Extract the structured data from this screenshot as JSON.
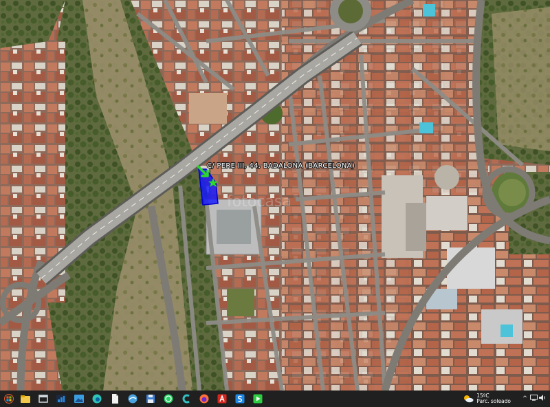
{
  "map": {
    "view": "satellite",
    "placemark": {
      "label": "C/ PERE III, 44, BADALONA (BARCELONA)",
      "parcel_color": "#1417ff",
      "marker_color": "#2bd92b"
    },
    "watermark": "fotocasa"
  },
  "taskbar": {
    "start_icon": "windows-logo-icon",
    "pinned": [
      {
        "name": "taskbar-item-explorer",
        "icon": "file-explorer-icon",
        "color": "#f2c94c"
      },
      {
        "name": "taskbar-item-windows",
        "icon": "window-icon",
        "color": "#cfd8dc"
      },
      {
        "name": "taskbar-item-photos",
        "icon": "photos-icon",
        "color": "#2a8ae0"
      },
      {
        "name": "taskbar-item-gallery",
        "icon": "landscape-icon",
        "color": "#3b9de0"
      },
      {
        "name": "taskbar-item-edge",
        "icon": "edge-icon",
        "color": "#2ec4b6"
      },
      {
        "name": "taskbar-item-document",
        "icon": "document-icon",
        "color": "#f2f2f2"
      },
      {
        "name": "taskbar-item-earth",
        "icon": "google-earth-icon",
        "color": "#4aa3df"
      },
      {
        "name": "taskbar-item-save",
        "icon": "floppy-disk-icon",
        "color": "#3d7fd1"
      },
      {
        "name": "taskbar-item-whatsapp",
        "icon": "whatsapp-icon",
        "color": "#25d366"
      },
      {
        "name": "taskbar-item-app",
        "icon": "c-logo-icon",
        "color": "#33c1c1"
      },
      {
        "name": "taskbar-item-firefox",
        "icon": "firefox-icon",
        "color": "#ff7139"
      },
      {
        "name": "taskbar-item-acrobat",
        "icon": "acrobat-icon",
        "color": "#d7261e"
      },
      {
        "name": "taskbar-item-s-app",
        "icon": "s-logo-icon",
        "color": "#1e88e5"
      },
      {
        "name": "taskbar-item-green-app",
        "icon": "green-app-icon",
        "color": "#2ecc40"
      }
    ],
    "weather": {
      "temp": "15ºC",
      "condition": "Parc. soleado"
    },
    "tray": {
      "chevron": "^",
      "icons": [
        "network-icon",
        "volume-icon"
      ]
    }
  }
}
